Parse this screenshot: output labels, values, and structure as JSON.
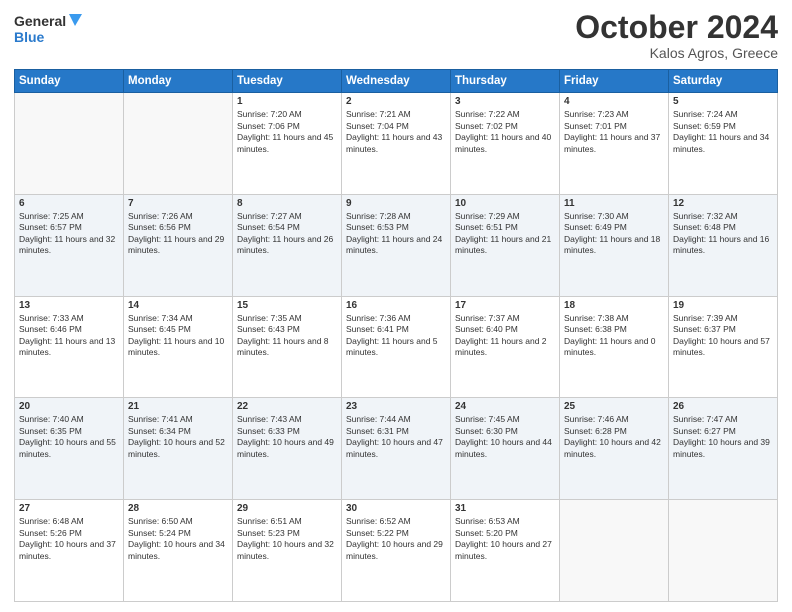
{
  "header": {
    "logo_line1": "General",
    "logo_line2": "Blue",
    "month": "October 2024",
    "location": "Kalos Agros, Greece"
  },
  "days_of_week": [
    "Sunday",
    "Monday",
    "Tuesday",
    "Wednesday",
    "Thursday",
    "Friday",
    "Saturday"
  ],
  "weeks": [
    [
      {
        "num": "",
        "info": ""
      },
      {
        "num": "",
        "info": ""
      },
      {
        "num": "1",
        "info": "Sunrise: 7:20 AM\nSunset: 7:06 PM\nDaylight: 11 hours and 45 minutes."
      },
      {
        "num": "2",
        "info": "Sunrise: 7:21 AM\nSunset: 7:04 PM\nDaylight: 11 hours and 43 minutes."
      },
      {
        "num": "3",
        "info": "Sunrise: 7:22 AM\nSunset: 7:02 PM\nDaylight: 11 hours and 40 minutes."
      },
      {
        "num": "4",
        "info": "Sunrise: 7:23 AM\nSunset: 7:01 PM\nDaylight: 11 hours and 37 minutes."
      },
      {
        "num": "5",
        "info": "Sunrise: 7:24 AM\nSunset: 6:59 PM\nDaylight: 11 hours and 34 minutes."
      }
    ],
    [
      {
        "num": "6",
        "info": "Sunrise: 7:25 AM\nSunset: 6:57 PM\nDaylight: 11 hours and 32 minutes."
      },
      {
        "num": "7",
        "info": "Sunrise: 7:26 AM\nSunset: 6:56 PM\nDaylight: 11 hours and 29 minutes."
      },
      {
        "num": "8",
        "info": "Sunrise: 7:27 AM\nSunset: 6:54 PM\nDaylight: 11 hours and 26 minutes."
      },
      {
        "num": "9",
        "info": "Sunrise: 7:28 AM\nSunset: 6:53 PM\nDaylight: 11 hours and 24 minutes."
      },
      {
        "num": "10",
        "info": "Sunrise: 7:29 AM\nSunset: 6:51 PM\nDaylight: 11 hours and 21 minutes."
      },
      {
        "num": "11",
        "info": "Sunrise: 7:30 AM\nSunset: 6:49 PM\nDaylight: 11 hours and 18 minutes."
      },
      {
        "num": "12",
        "info": "Sunrise: 7:32 AM\nSunset: 6:48 PM\nDaylight: 11 hours and 16 minutes."
      }
    ],
    [
      {
        "num": "13",
        "info": "Sunrise: 7:33 AM\nSunset: 6:46 PM\nDaylight: 11 hours and 13 minutes."
      },
      {
        "num": "14",
        "info": "Sunrise: 7:34 AM\nSunset: 6:45 PM\nDaylight: 11 hours and 10 minutes."
      },
      {
        "num": "15",
        "info": "Sunrise: 7:35 AM\nSunset: 6:43 PM\nDaylight: 11 hours and 8 minutes."
      },
      {
        "num": "16",
        "info": "Sunrise: 7:36 AM\nSunset: 6:41 PM\nDaylight: 11 hours and 5 minutes."
      },
      {
        "num": "17",
        "info": "Sunrise: 7:37 AM\nSunset: 6:40 PM\nDaylight: 11 hours and 2 minutes."
      },
      {
        "num": "18",
        "info": "Sunrise: 7:38 AM\nSunset: 6:38 PM\nDaylight: 11 hours and 0 minutes."
      },
      {
        "num": "19",
        "info": "Sunrise: 7:39 AM\nSunset: 6:37 PM\nDaylight: 10 hours and 57 minutes."
      }
    ],
    [
      {
        "num": "20",
        "info": "Sunrise: 7:40 AM\nSunset: 6:35 PM\nDaylight: 10 hours and 55 minutes."
      },
      {
        "num": "21",
        "info": "Sunrise: 7:41 AM\nSunset: 6:34 PM\nDaylight: 10 hours and 52 minutes."
      },
      {
        "num": "22",
        "info": "Sunrise: 7:43 AM\nSunset: 6:33 PM\nDaylight: 10 hours and 49 minutes."
      },
      {
        "num": "23",
        "info": "Sunrise: 7:44 AM\nSunset: 6:31 PM\nDaylight: 10 hours and 47 minutes."
      },
      {
        "num": "24",
        "info": "Sunrise: 7:45 AM\nSunset: 6:30 PM\nDaylight: 10 hours and 44 minutes."
      },
      {
        "num": "25",
        "info": "Sunrise: 7:46 AM\nSunset: 6:28 PM\nDaylight: 10 hours and 42 minutes."
      },
      {
        "num": "26",
        "info": "Sunrise: 7:47 AM\nSunset: 6:27 PM\nDaylight: 10 hours and 39 minutes."
      }
    ],
    [
      {
        "num": "27",
        "info": "Sunrise: 6:48 AM\nSunset: 5:26 PM\nDaylight: 10 hours and 37 minutes."
      },
      {
        "num": "28",
        "info": "Sunrise: 6:50 AM\nSunset: 5:24 PM\nDaylight: 10 hours and 34 minutes."
      },
      {
        "num": "29",
        "info": "Sunrise: 6:51 AM\nSunset: 5:23 PM\nDaylight: 10 hours and 32 minutes."
      },
      {
        "num": "30",
        "info": "Sunrise: 6:52 AM\nSunset: 5:22 PM\nDaylight: 10 hours and 29 minutes."
      },
      {
        "num": "31",
        "info": "Sunrise: 6:53 AM\nSunset: 5:20 PM\nDaylight: 10 hours and 27 minutes."
      },
      {
        "num": "",
        "info": ""
      },
      {
        "num": "",
        "info": ""
      }
    ]
  ]
}
